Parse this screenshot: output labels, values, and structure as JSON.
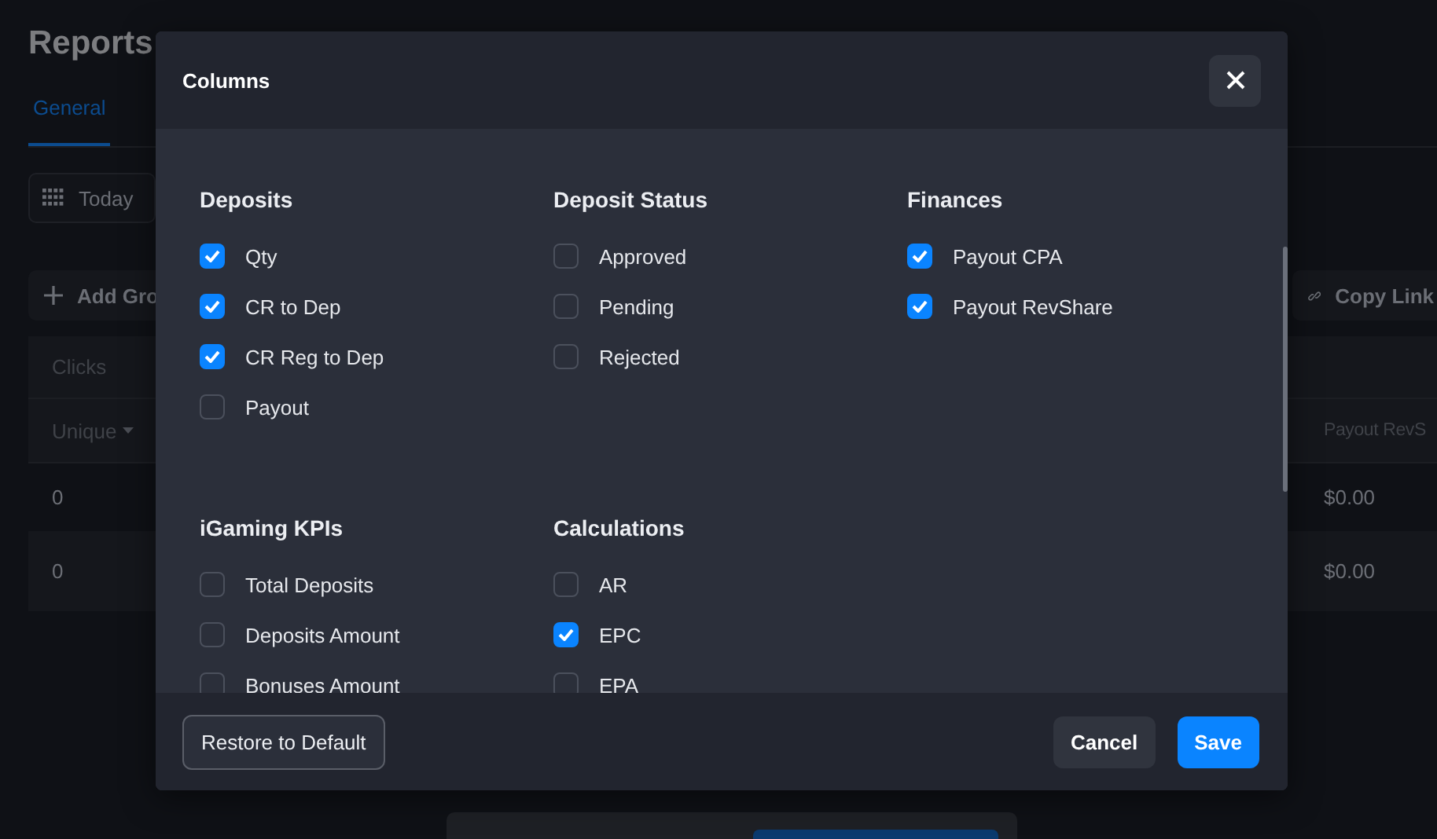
{
  "page": {
    "title": "Reports",
    "tabs": [
      {
        "label": "General",
        "selected": true
      }
    ],
    "date_button": "Today",
    "add_button": "Add Gro",
    "copy_link": "Copy Link",
    "table": {
      "group": "Clicks",
      "columns": [
        "Unique",
        "Payout RevS"
      ],
      "rows": [
        [
          "0",
          "$0.00"
        ],
        [
          "0",
          "$0.00"
        ]
      ]
    }
  },
  "modal": {
    "title": "Columns",
    "sections": [
      {
        "title": "Deposits",
        "items": [
          {
            "label": "Qty",
            "checked": true
          },
          {
            "label": "CR to Dep",
            "checked": true
          },
          {
            "label": "CR Reg to Dep",
            "checked": true
          },
          {
            "label": "Payout",
            "checked": false
          }
        ]
      },
      {
        "title": "Deposit Status",
        "items": [
          {
            "label": "Approved",
            "checked": false
          },
          {
            "label": "Pending",
            "checked": false
          },
          {
            "label": "Rejected",
            "checked": false
          }
        ]
      },
      {
        "title": "Finances",
        "items": [
          {
            "label": "Payout CPA",
            "checked": true
          },
          {
            "label": "Payout RevShare",
            "checked": true
          }
        ]
      },
      {
        "title": "iGaming KPIs",
        "items": [
          {
            "label": "Total Deposits",
            "checked": false
          },
          {
            "label": "Deposits Amount",
            "checked": false
          },
          {
            "label": "Bonuses Amount",
            "checked": false
          }
        ]
      },
      {
        "title": "Calculations",
        "items": [
          {
            "label": "AR",
            "checked": false
          },
          {
            "label": "EPC",
            "checked": true
          },
          {
            "label": "EPA",
            "checked": false
          }
        ]
      }
    ],
    "restore_button": "Restore to Default",
    "cancel_button": "Cancel",
    "save_button": "Save"
  }
}
